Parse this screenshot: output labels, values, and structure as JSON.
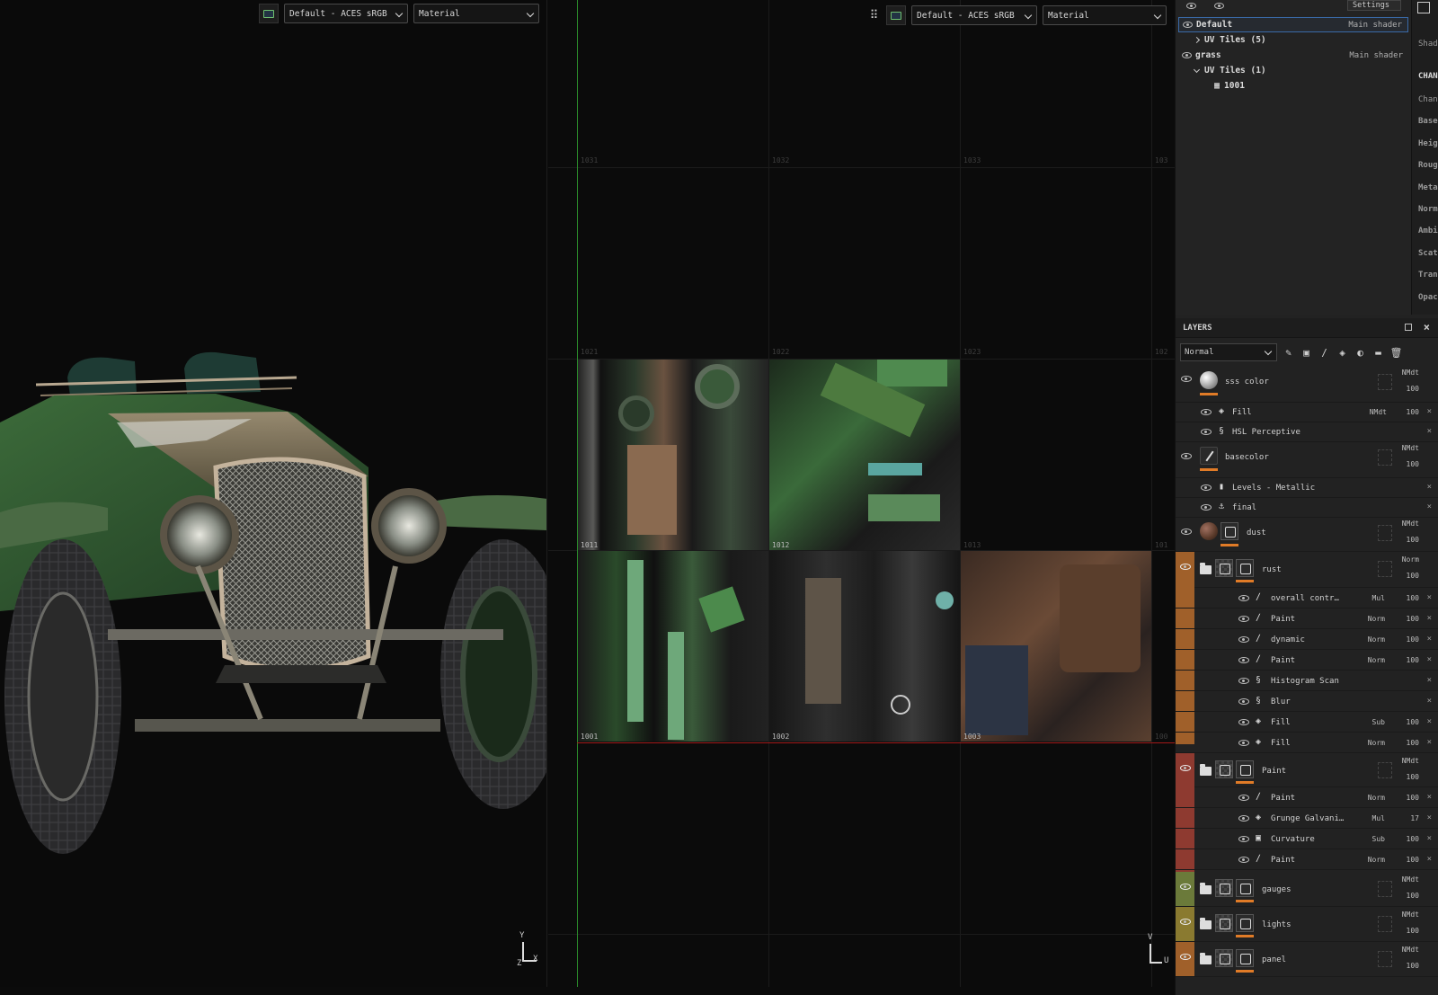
{
  "viewport3d": {
    "colorspace": "Default - ACES sRGB",
    "channel": "Material",
    "gizmo": {
      "y": "Y",
      "z": "Z",
      "x": "X"
    }
  },
  "viewport2d": {
    "colorspace": "Default - ACES sRGB",
    "channel": "Material",
    "gizmo": {
      "v": "V",
      "u": "U"
    },
    "tiles_row1": [
      "1031",
      "1032",
      "1033",
      "103"
    ],
    "tiles_row2": [
      "1021",
      "1022",
      "1023",
      "102"
    ],
    "tiles_row3": [
      "1011",
      "1012",
      "1013",
      "101"
    ],
    "tiles_row4": [
      "1001",
      "1002",
      "1003",
      "100"
    ]
  },
  "texture_sets": {
    "settings_label": "Settings",
    "items": [
      {
        "name": "Default",
        "shader": "Main shader",
        "selected": true
      },
      {
        "name": "UV Tiles (5)",
        "child": true
      },
      {
        "name": "grass",
        "shader": "Main shader"
      },
      {
        "name": "UV Tiles (1)",
        "child": true
      },
      {
        "name": "1001",
        "grandchild": true
      }
    ]
  },
  "props_strip": [
    "Shad",
    "CHAN",
    "Chan",
    "Base",
    "Heig",
    "Roug",
    "Meta",
    "Norm",
    "Ambi",
    "Scat",
    "Tran",
    "Opac"
  ],
  "layers": {
    "title": "LAYERS",
    "blend_mode": "Normal",
    "list": [
      {
        "name": "sss color",
        "blend": "NMdt",
        "opacity": "100"
      },
      {
        "name": "Fill",
        "blend": "NMdt",
        "opacity": "100"
      },
      {
        "name": "HSL Perceptive"
      },
      {
        "name": "basecolor",
        "blend": "NMdt",
        "opacity": "100"
      },
      {
        "name": "Levels - Metallic"
      },
      {
        "name": "final"
      },
      {
        "name": "dust",
        "blend": "NMdt",
        "opacity": "100"
      },
      {
        "name": "rust",
        "blend": "Norm",
        "opacity": "100"
      },
      {
        "name": "overall contr…",
        "blend": "Mul",
        "opacity": "100"
      },
      {
        "name": "Paint",
        "blend": "Norm",
        "opacity": "100"
      },
      {
        "name": "dynamic",
        "blend": "Norm",
        "opacity": "100"
      },
      {
        "name": "Paint",
        "blend": "Norm",
        "opacity": "100"
      },
      {
        "name": "Histogram Scan"
      },
      {
        "name": "Blur"
      },
      {
        "name": "Fill",
        "blend": "Sub",
        "opacity": "100"
      },
      {
        "name": "Fill",
        "blend": "Norm",
        "opacity": "100"
      },
      {
        "name": "Paint",
        "blend": "NMdt",
        "opacity": "100"
      },
      {
        "name": "Paint",
        "blend": "Norm",
        "opacity": "100"
      },
      {
        "name": "Grunge Galvani…",
        "blend": "Mul",
        "opacity": "17"
      },
      {
        "name": "Curvature",
        "blend": "Sub",
        "opacity": "100"
      },
      {
        "name": "Paint",
        "blend": "Norm",
        "opacity": "100"
      },
      {
        "name": "gauges",
        "blend": "NMdt",
        "opacity": "100"
      },
      {
        "name": "lights",
        "blend": "NMdt",
        "opacity": "100"
      },
      {
        "name": "panel",
        "blend": "NMdt",
        "opacity": "100"
      }
    ]
  },
  "colors": {
    "rust_group": "#a0602a",
    "paint_group": "#8e3a30",
    "gauges_group": "#6b7a3a",
    "lights_group": "#8a7a30",
    "panel_group": "#a0602a",
    "accent_orange": "#e07b27",
    "uv_axis_green": "#2b8c2b",
    "uv_axis_red": "#a31818"
  }
}
